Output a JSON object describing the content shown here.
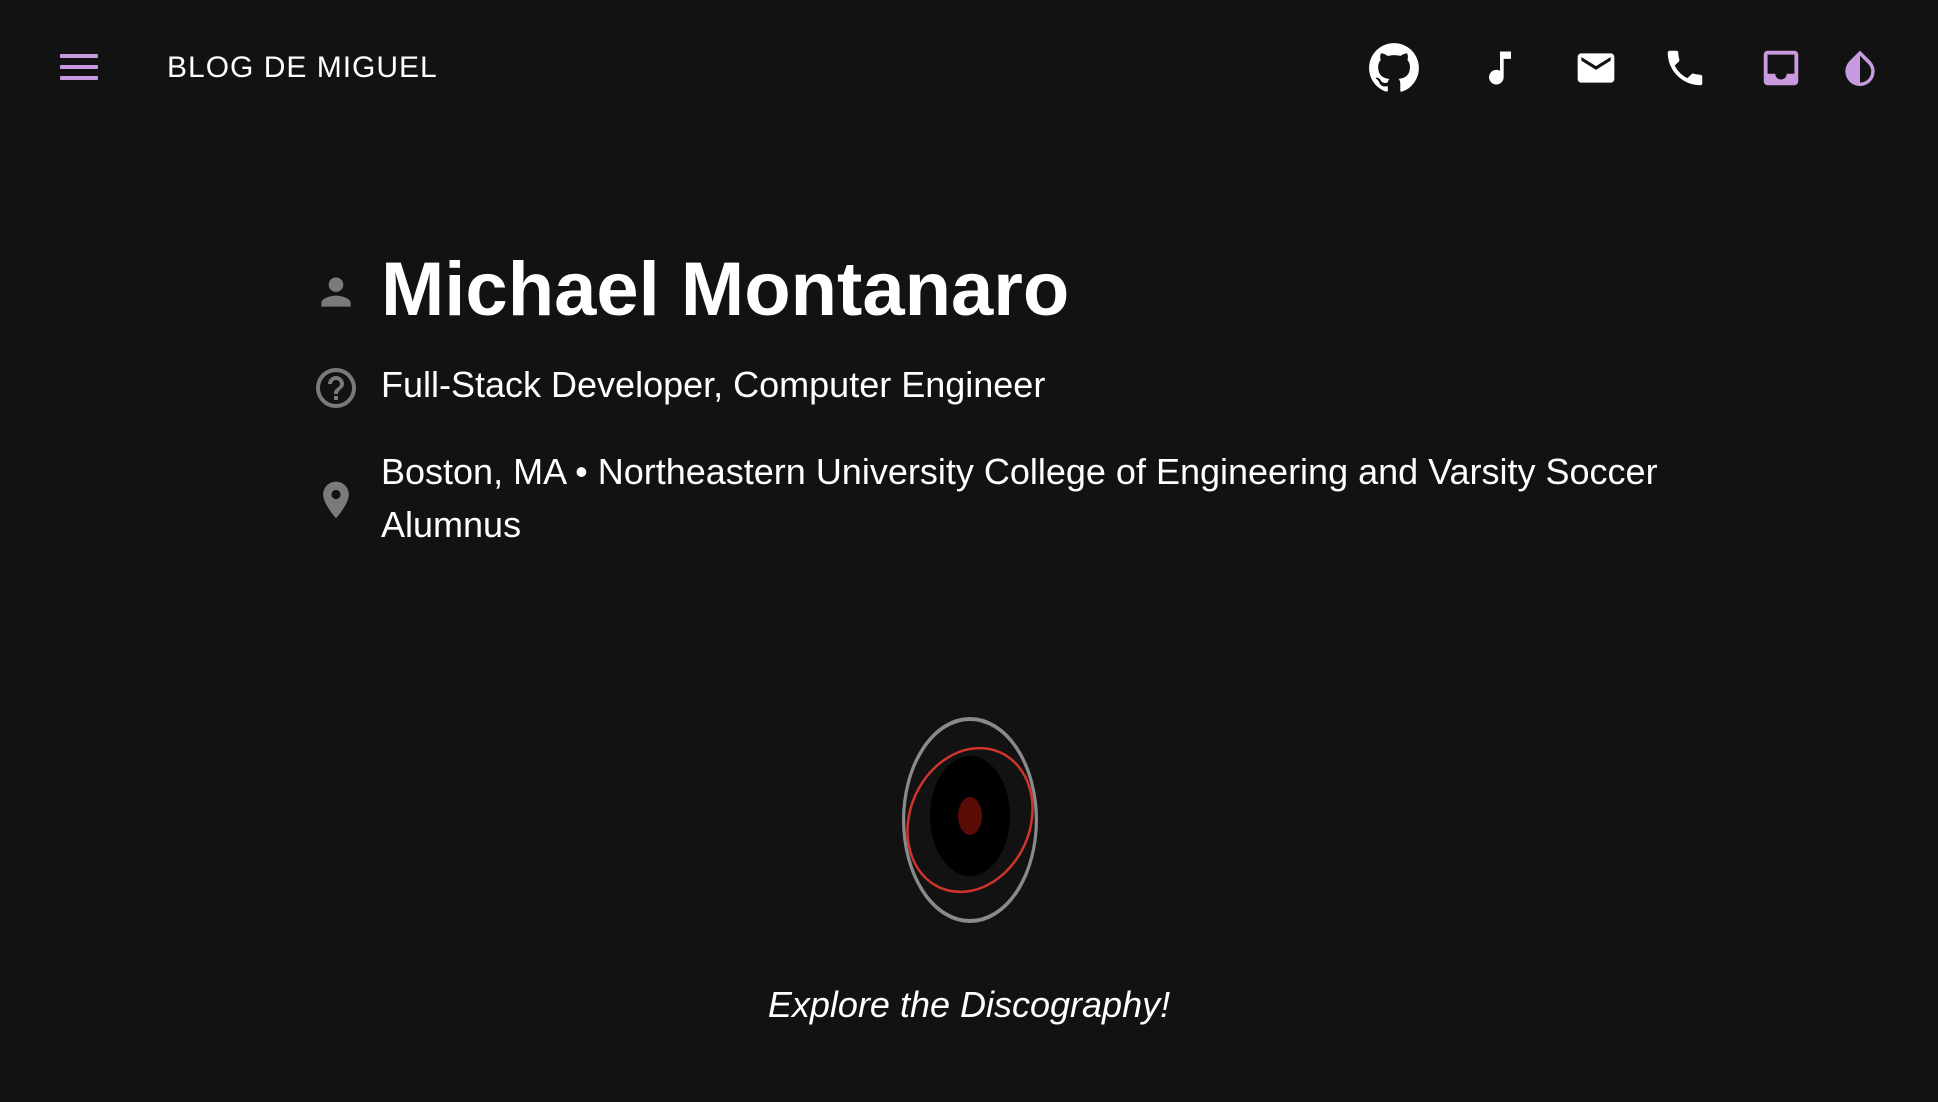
{
  "topbar": {
    "brand": "BLOG DE MIGUEL",
    "icons": [
      "menu-icon",
      "github-icon",
      "music-note-icon",
      "email-icon",
      "phone-icon",
      "inbox-icon",
      "theme-toggle-icon"
    ],
    "accent_color": "#c89be0"
  },
  "profile": {
    "name": "Michael Montanaro",
    "role": "Full-Stack Developer, Computer Engineer",
    "location": "Boston, MA • Northeastern University College of Engineering and Varsity Soccer Alumnus"
  },
  "cta": {
    "label": "Explore the Discography!"
  },
  "colors": {
    "background": "#121212",
    "icon_gray": "#7a7a7a",
    "disc_red": "#d0352b"
  }
}
